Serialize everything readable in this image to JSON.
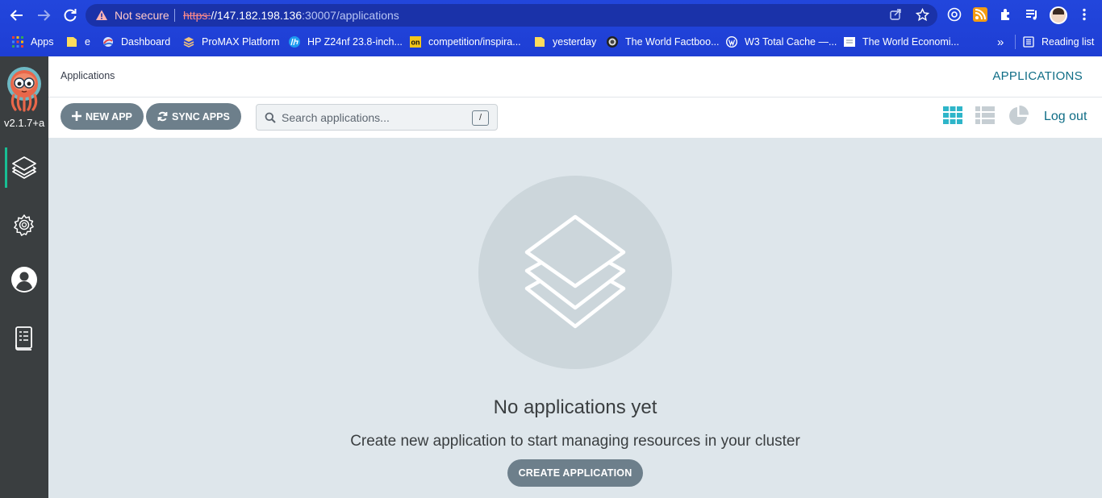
{
  "browser": {
    "security_label": "Not secure",
    "url_scheme": "https:",
    "url_host": "//147.182.198.136",
    "url_path": ":30007/applications",
    "colors": {
      "chrome": "#1f3fd6",
      "omnibox": "#1a32a9"
    }
  },
  "bookmarks": {
    "items": [
      {
        "label": "Apps",
        "icon": "apps-grid-icon"
      },
      {
        "label": "e",
        "icon": "folder-icon"
      },
      {
        "label": "Dashboard",
        "icon": "dashboard-icon"
      },
      {
        "label": "ProMAX Platform",
        "icon": "promax-icon"
      },
      {
        "label": "HP Z24nf 23.8-inch...",
        "icon": "hp-icon"
      },
      {
        "label": "competition/inspira...",
        "icon": "on-icon"
      },
      {
        "label": "yesterday",
        "icon": "folder-icon"
      },
      {
        "label": "The World Factboo...",
        "icon": "factbook-icon"
      },
      {
        "label": "W3 Total Cache —...",
        "icon": "wordpress-icon"
      },
      {
        "label": "The World Economi...",
        "icon": "page-icon"
      }
    ],
    "more": "»",
    "reading_list": "Reading list"
  },
  "sidebar": {
    "version": "v2.1.7+a",
    "items": [
      "applications-icon",
      "settings-icon",
      "user-icon",
      "docs-icon"
    ],
    "accent": "#18be94"
  },
  "header": {
    "breadcrumb": "Applications",
    "title": "APPLICATIONS"
  },
  "toolbar": {
    "new_app": "NEW APP",
    "sync_apps": "SYNC APPS",
    "search_placeholder": "Search applications...",
    "search_shortcut": "/",
    "logout": "Log out",
    "active_view": "tiles"
  },
  "empty_state": {
    "title": "No applications yet",
    "subtitle": "Create new application to start managing resources in your cluster",
    "button": "CREATE APPLICATION"
  }
}
